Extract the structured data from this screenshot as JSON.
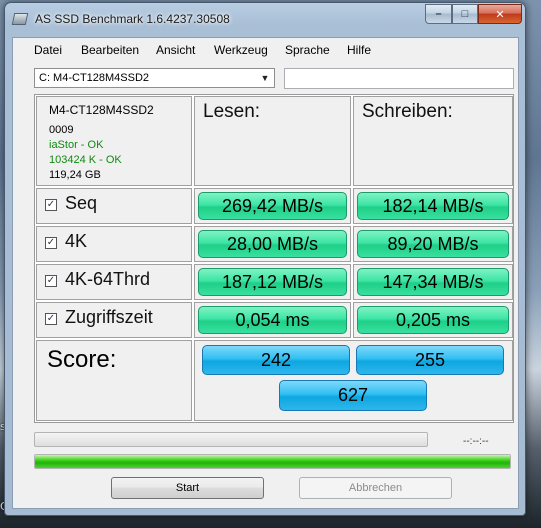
{
  "window": {
    "title": "AS SSD Benchmark 1.6.4237.30508"
  },
  "desktop": {
    "fragment_1": "sM",
    "fragment_2": "OO"
  },
  "menu": [
    "Datei",
    "Bearbeiten",
    "Ansicht",
    "Werkzeug",
    "Sprache",
    "Hilfe"
  ],
  "drive_select": {
    "value": "C: M4-CT128M4SSD2"
  },
  "drive_info": {
    "name": "M4-CT128M4SSD2",
    "firmware": "0009",
    "driver": "iaStor - OK",
    "alignment": "103424 K - OK",
    "size": "119,24 GB",
    "status_color": "#108a10"
  },
  "headers": {
    "read": "Lesen:",
    "write": "Schreiben:"
  },
  "tests": [
    {
      "label": "Seq",
      "checked": true,
      "read": "269,42 MB/s",
      "write": "182,14 MB/s"
    },
    {
      "label": "4K",
      "checked": true,
      "read": "28,00 MB/s",
      "write": "89,20 MB/s"
    },
    {
      "label": "4K-64Thrd",
      "checked": true,
      "read": "187,12 MB/s",
      "write": "147,34 MB/s"
    },
    {
      "label": "Zugriffszeit",
      "checked": true,
      "read": "0,054 ms",
      "write": "0,205 ms"
    }
  ],
  "score": {
    "label": "Score:",
    "read": "242",
    "write": "255",
    "total": "627"
  },
  "progress": {
    "upper_fraction": 0.0,
    "lower_fraction": 1.0,
    "time": "--:--:--"
  },
  "buttons": {
    "start": "Start",
    "abort": "Abbrechen"
  },
  "colors": {
    "result_green": "#3ee5a5",
    "score_blue": "#31bff2",
    "progress_green": "#22b30c"
  }
}
